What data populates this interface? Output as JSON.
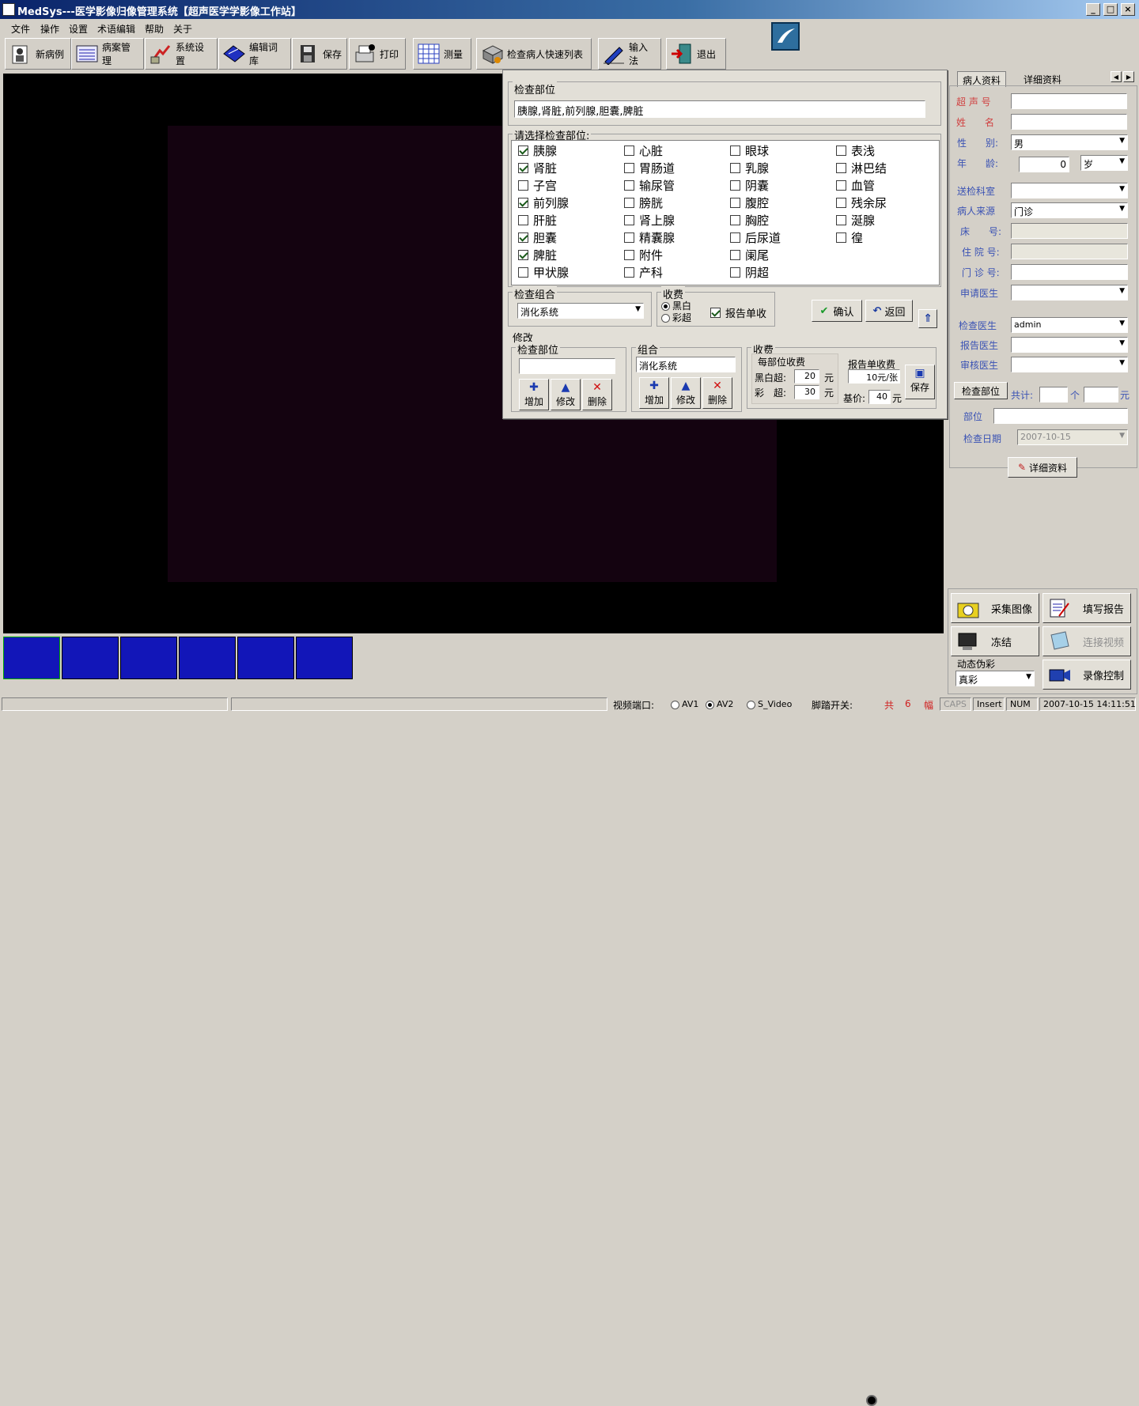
{
  "window": {
    "title": "MedSys---医学影像归像管理系统【超声医学学影像工作站】"
  },
  "menu": [
    "文件",
    "操作",
    "设置",
    "术语编辑",
    "帮助",
    "关于"
  ],
  "toolbar": [
    {
      "label": "新病例",
      "icon": "new-case-icon"
    },
    {
      "label": "病案管理",
      "icon": "records-icon"
    },
    {
      "label": "系统设置",
      "icon": "settings-icon"
    },
    {
      "label": "编辑词库",
      "icon": "dictionary-icon"
    },
    {
      "label": "保存",
      "icon": "save-icon"
    },
    {
      "label": "打印",
      "icon": "printer-icon"
    },
    {
      "label": "测量",
      "icon": "grid-icon"
    },
    {
      "label": "检查病人快速列表",
      "icon": "patient-list-icon"
    },
    {
      "label": "输入法",
      "icon": "pen-icon"
    },
    {
      "label": "退出",
      "icon": "exit-icon"
    }
  ],
  "dialog": {
    "exam_site_legend": "检查部位",
    "exam_site_value": "胰腺,肾脏,前列腺,胆囊,脾脏",
    "select_legend": "请选择检查部位:",
    "sites": [
      [
        {
          "label": "胰腺",
          "checked": true
        },
        {
          "label": "肾脏",
          "checked": true
        },
        {
          "label": "子宫",
          "checked": false
        },
        {
          "label": "前列腺",
          "checked": true
        },
        {
          "label": "肝脏",
          "checked": false
        },
        {
          "label": "胆囊",
          "checked": true
        },
        {
          "label": "脾脏",
          "checked": true
        },
        {
          "label": "甲状腺",
          "checked": false
        }
      ],
      [
        {
          "label": "心脏",
          "checked": false
        },
        {
          "label": "胃肠道",
          "checked": false
        },
        {
          "label": "输尿管",
          "checked": false
        },
        {
          "label": "膀胱",
          "checked": false
        },
        {
          "label": "肾上腺",
          "checked": false
        },
        {
          "label": "精囊腺",
          "checked": false
        },
        {
          "label": "附件",
          "checked": false
        },
        {
          "label": "产科",
          "checked": false
        }
      ],
      [
        {
          "label": "眼球",
          "checked": false
        },
        {
          "label": "乳腺",
          "checked": false
        },
        {
          "label": "阴囊",
          "checked": false
        },
        {
          "label": "腹腔",
          "checked": false
        },
        {
          "label": "胸腔",
          "checked": false
        },
        {
          "label": "后尿道",
          "checked": false
        },
        {
          "label": "阑尾",
          "checked": false
        },
        {
          "label": "阴超",
          "checked": false
        }
      ],
      [
        {
          "label": "表浅",
          "checked": false
        },
        {
          "label": "淋巴结",
          "checked": false
        },
        {
          "label": "血管",
          "checked": false
        },
        {
          "label": "残余尿",
          "checked": false
        },
        {
          "label": "涎腺",
          "checked": false
        },
        {
          "label": "徨",
          "checked": false
        }
      ]
    ],
    "combo_legend": "检查组合",
    "combo_value": "消化系统",
    "fee_legend": "收费",
    "fee_bw": "黑白",
    "fee_color": "彩超",
    "report_fee": "报告单收",
    "confirm": "确认",
    "back": "返回",
    "edit_legend": "修改",
    "edit_site_legend": "检查部位",
    "edit_site_value": "",
    "edit_combo_legend": "组合",
    "edit_combo_value": "消化系统",
    "add": "增加",
    "modify": "修改",
    "delete": "删除",
    "edit_fee_legend": "收费",
    "per_site_fee": "每部位收费",
    "bw_label": "黑白超:",
    "bw_value": "20",
    "color_label": "彩　超:",
    "color_value": "30",
    "yuan": "元",
    "report_fee_legend": "报告单收费",
    "report_fee_value": "10",
    "report_fee_unit": "元/张",
    "base_label": "基价:",
    "base_value": "40",
    "save": "保存"
  },
  "right": {
    "tab_patient": "病人资料",
    "tab_detail": "详细资料",
    "ultrasound_no_label": "超 声 号",
    "name_label": "姓　　名",
    "sex_label": "性　　别:",
    "sex_value": "男",
    "age_label": "年　　龄:",
    "age_value": "0",
    "age_unit": "岁",
    "dept_label": "送检科室",
    "source_label": "病人来源",
    "source_value": "门诊",
    "bed_label": "床　　号:",
    "inpatient_label": "住 院 号:",
    "outpatient_label": "门 诊 号:",
    "applicant_label": "申请医生",
    "exam_doctor_label": "检查医生",
    "exam_doctor_value": "admin",
    "report_doctor_label": "报告医生",
    "review_doctor_label": "审核医生",
    "exam_site_btn": "检查部位",
    "total_label": "共计:",
    "count_unit": "个",
    "yuan": "元",
    "site_label": "部位",
    "date_label": "检查日期",
    "date_value": "2007-10-15",
    "detail_btn": "详细资料"
  },
  "controls": {
    "capture": "采集图像",
    "report": "填写报告",
    "freeze": "冻结",
    "continuous": "连接视频",
    "pseudo_label": "动态伪彩",
    "pseudo_value": "真彩",
    "record": "录像控制"
  },
  "status": {
    "video_port": "视频端口:",
    "av1": "AV1",
    "av2": "AV2",
    "svideo": "S_Video",
    "pedal": "脚踏开关:",
    "total": "共",
    "count": "6",
    "unit": "幅",
    "caps": "CAPS",
    "insert": "Insert",
    "num": "NUM",
    "datetime": "2007-10-15  14:11:51"
  }
}
